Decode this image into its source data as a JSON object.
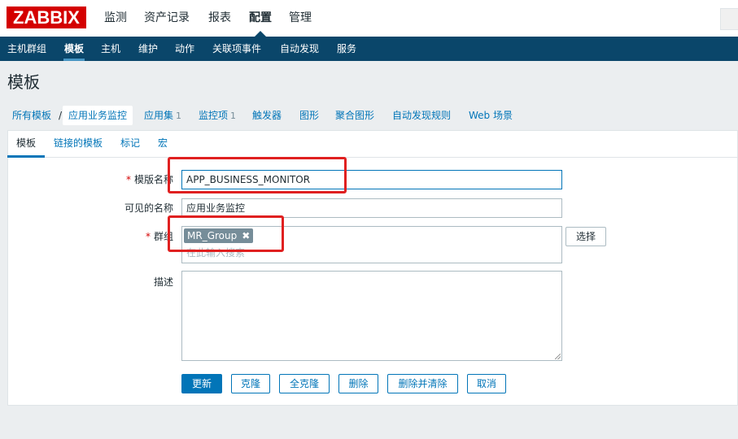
{
  "brand": {
    "logo_text": "ZABBIX",
    "logo_color": "#d40000"
  },
  "top_menu": [
    {
      "label": "监测"
    },
    {
      "label": "资产记录"
    },
    {
      "label": "报表"
    },
    {
      "label": "配置",
      "active": true
    },
    {
      "label": "管理"
    }
  ],
  "sub_menu": [
    {
      "label": "主机群组"
    },
    {
      "label": "模板",
      "active": true
    },
    {
      "label": "主机"
    },
    {
      "label": "维护"
    },
    {
      "label": "动作"
    },
    {
      "label": "关联项事件"
    },
    {
      "label": "自动发现"
    },
    {
      "label": "服务"
    }
  ],
  "page": {
    "title": "模板"
  },
  "breadcrumb": {
    "all_templates": "所有模板",
    "separator": "/",
    "current": "应用业务监控",
    "items": [
      {
        "label": "应用集",
        "count": "1"
      },
      {
        "label": "监控项",
        "count": "1"
      },
      {
        "label": "触发器"
      },
      {
        "label": "图形"
      },
      {
        "label": "聚合图形"
      },
      {
        "label": "自动发现规则"
      },
      {
        "label": "Web 场景"
      }
    ]
  },
  "form_tabs": [
    {
      "label": "模板",
      "active": true
    },
    {
      "label": "链接的模板"
    },
    {
      "label": "标记"
    },
    {
      "label": "宏"
    }
  ],
  "form": {
    "template_name": {
      "label": "模版名称",
      "required_mark": "*",
      "value": "APP_BUSINESS_MONITOR"
    },
    "visible_name": {
      "label": "可见的名称",
      "value": "应用业务监控"
    },
    "groups": {
      "label": "群组",
      "required_mark": "*",
      "tag": "MR_Group",
      "tag_remove": "✖",
      "placeholder": "在此输入搜索",
      "select_button": "选择"
    },
    "description": {
      "label": "描述",
      "value": ""
    }
  },
  "buttons": {
    "update": "更新",
    "clone": "克隆",
    "full_clone": "全克隆",
    "delete": "删除",
    "delete_clear": "删除并清除",
    "cancel": "取消"
  },
  "colors": {
    "nav_bg": "#0a466a",
    "accent": "#0275b8",
    "annotation": "#e02020"
  }
}
